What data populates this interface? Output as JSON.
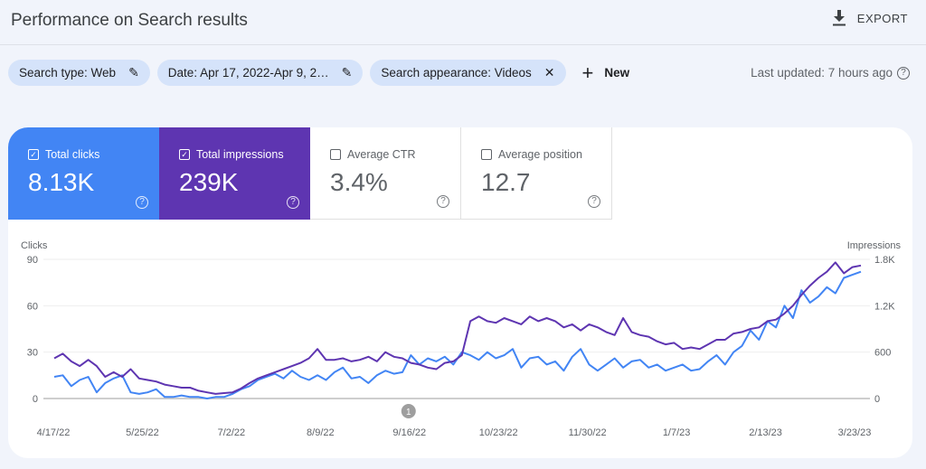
{
  "header": {
    "title": "Performance on Search results",
    "export_label": "EXPORT"
  },
  "filters": {
    "chips": [
      {
        "label": "Search type: Web",
        "icon": "pencil-icon"
      },
      {
        "label": "Date: Apr 17, 2022-Apr 9, 2…",
        "icon": "pencil-icon"
      },
      {
        "label": "Search appearance: Videos",
        "icon": "close-icon"
      }
    ],
    "new_label": "New",
    "last_updated": "Last updated: 7 hours ago"
  },
  "metrics": [
    {
      "label": "Total clicks",
      "value": "8.13K",
      "checked": true,
      "color": "#4285f4"
    },
    {
      "label": "Total impressions",
      "value": "239K",
      "checked": true,
      "color": "#5e35b1"
    },
    {
      "label": "Average CTR",
      "value": "3.4%",
      "checked": false
    },
    {
      "label": "Average position",
      "value": "12.7",
      "checked": false
    }
  ],
  "chart_data": {
    "type": "line",
    "left_axis": {
      "label": "Clicks",
      "ticks": [
        "0",
        "30",
        "60",
        "90"
      ],
      "range": [
        0,
        90
      ]
    },
    "right_axis": {
      "label": "Impressions",
      "ticks": [
        "0",
        "600",
        "1.2K",
        "1.8K"
      ],
      "range": [
        0,
        1800
      ]
    },
    "x_tick_labels": [
      "4/17/22",
      "5/25/22",
      "7/2/22",
      "8/9/22",
      "9/16/22",
      "10/23/22",
      "11/30/22",
      "1/7/23",
      "2/13/23",
      "3/23/23"
    ],
    "annotation": {
      "label": "1",
      "date": "9/16/22"
    },
    "grid": true,
    "series": [
      {
        "name": "Clicks",
        "axis": "left",
        "color": "#4285f4",
        "values": [
          14,
          15,
          8,
          12,
          14,
          4,
          10,
          13,
          15,
          4,
          3,
          4,
          6,
          1,
          1,
          2,
          1,
          1,
          0,
          1,
          1,
          3,
          6,
          8,
          12,
          14,
          16,
          13,
          18,
          14,
          12,
          15,
          12,
          17,
          20,
          13,
          14,
          10,
          15,
          18,
          16,
          17,
          28,
          22,
          26,
          24,
          27,
          22,
          30,
          28,
          25,
          30,
          26,
          28,
          32,
          20,
          26,
          27,
          22,
          24,
          18,
          27,
          32,
          22,
          18,
          22,
          26,
          20,
          24,
          25,
          20,
          22,
          18,
          20,
          22,
          18,
          19,
          24,
          28,
          22,
          30,
          34,
          44,
          38,
          50,
          46,
          60,
          52,
          70,
          62,
          66,
          72,
          68,
          78,
          80,
          82
        ]
      },
      {
        "name": "Impressions",
        "axis": "right",
        "color": "#5e35b1",
        "values": [
          520,
          580,
          480,
          420,
          500,
          420,
          280,
          340,
          280,
          380,
          260,
          240,
          220,
          180,
          160,
          140,
          140,
          100,
          80,
          60,
          70,
          80,
          130,
          200,
          260,
          300,
          340,
          380,
          420,
          460,
          520,
          640,
          500,
          500,
          520,
          480,
          500,
          540,
          480,
          600,
          540,
          520,
          460,
          440,
          400,
          380,
          460,
          480,
          560,
          1000,
          1060,
          1000,
          980,
          1040,
          1000,
          960,
          1060,
          1000,
          1040,
          1000,
          920,
          960,
          880,
          960,
          920,
          860,
          820,
          1040,
          860,
          820,
          800,
          740,
          700,
          720,
          640,
          660,
          640,
          700,
          760,
          760,
          840,
          860,
          900,
          920,
          1000,
          1020,
          1100,
          1200,
          1340,
          1460,
          1560,
          1640,
          1760,
          1620,
          1700,
          1720
        ]
      }
    ]
  }
}
